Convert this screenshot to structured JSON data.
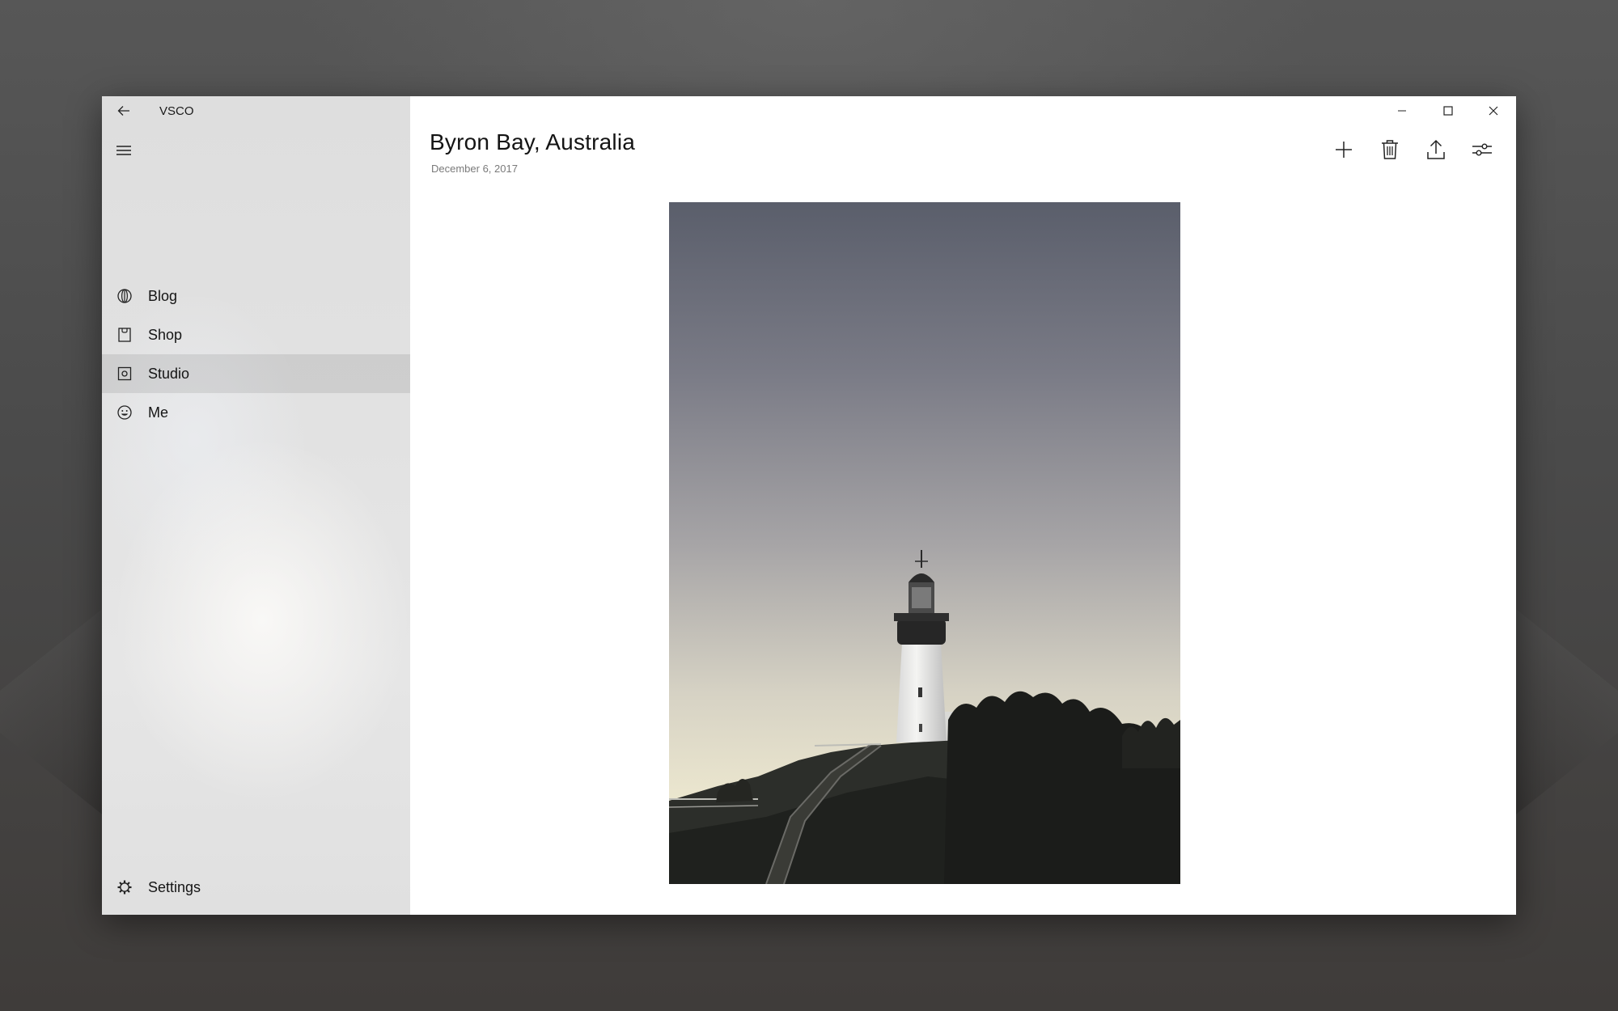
{
  "app": {
    "title": "VSCO"
  },
  "sidebar": {
    "items": [
      {
        "label": "Blog",
        "icon": "globe-icon",
        "selected": false
      },
      {
        "label": "Shop",
        "icon": "shopping-bag-icon",
        "selected": false
      },
      {
        "label": "Studio",
        "icon": "studio-icon",
        "selected": true
      },
      {
        "label": "Me",
        "icon": "face-icon",
        "selected": false
      }
    ],
    "settings": {
      "label": "Settings",
      "icon": "gear-icon"
    }
  },
  "header": {
    "title": "Byron Bay, Australia",
    "date": "December 6, 2017"
  },
  "toolbar": {
    "actions": [
      {
        "name": "add",
        "icon": "plus-icon"
      },
      {
        "name": "delete",
        "icon": "trash-icon"
      },
      {
        "name": "share",
        "icon": "share-icon"
      },
      {
        "name": "edit",
        "icon": "sliders-icon"
      }
    ]
  },
  "window_controls": [
    "minimize-icon",
    "maximize-icon",
    "close-icon"
  ],
  "colors": {
    "sidebar_bg": "#e0e0e0",
    "selected_item_bg": "#d2d2d2",
    "text_primary": "#151515",
    "text_secondary": "#7a7a7a",
    "desktop_bg": "#4a4a4a"
  }
}
